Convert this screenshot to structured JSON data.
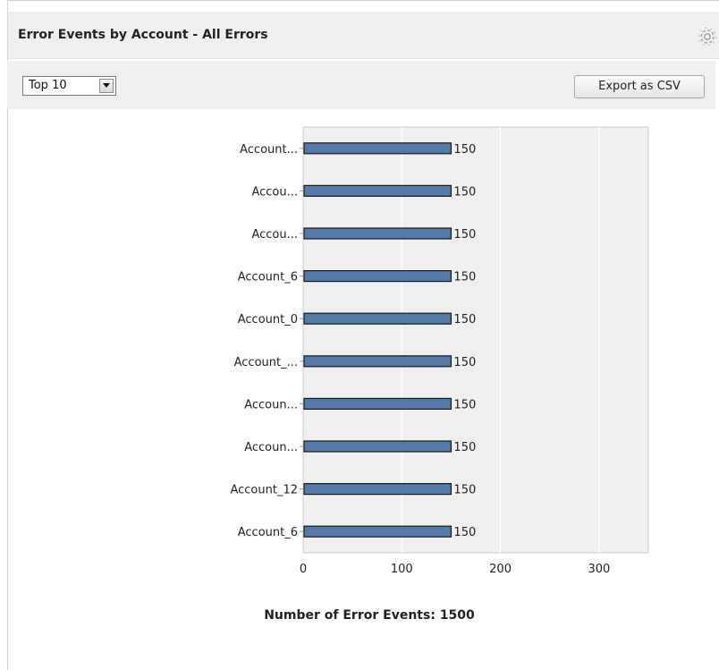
{
  "widget": {
    "title": "Error Events by Account - All Errors"
  },
  "toolbar": {
    "top_select_value": "Top 10",
    "export_label": "Export as CSV"
  },
  "icons": {
    "settings": "gear-icon",
    "dropdown": "chevron-down-icon"
  },
  "chart_data": {
    "type": "bar",
    "orientation": "horizontal",
    "categories": [
      "Account...",
      "Accou...",
      "Accou...",
      "Account_6",
      "Account_0",
      "Account_...",
      "Accoun...",
      "Accoun...",
      "Account_12",
      "Account_6"
    ],
    "values": [
      150,
      150,
      150,
      150,
      150,
      150,
      150,
      150,
      150,
      150
    ],
    "data_labels": [
      "150",
      "150",
      "150",
      "150",
      "150",
      "150",
      "150",
      "150",
      "150",
      "150"
    ],
    "x_ticks": [
      "0",
      "100",
      "200",
      "300"
    ],
    "x_tick_values": [
      0,
      100,
      200,
      300
    ],
    "xlim": [
      0,
      350
    ],
    "grid": true,
    "bar_color": "#5279a8",
    "bar_edge_color": "#1a1a1a",
    "plot_background": "#efefef"
  },
  "summary": {
    "text": "Number of Error Events: 1500"
  }
}
